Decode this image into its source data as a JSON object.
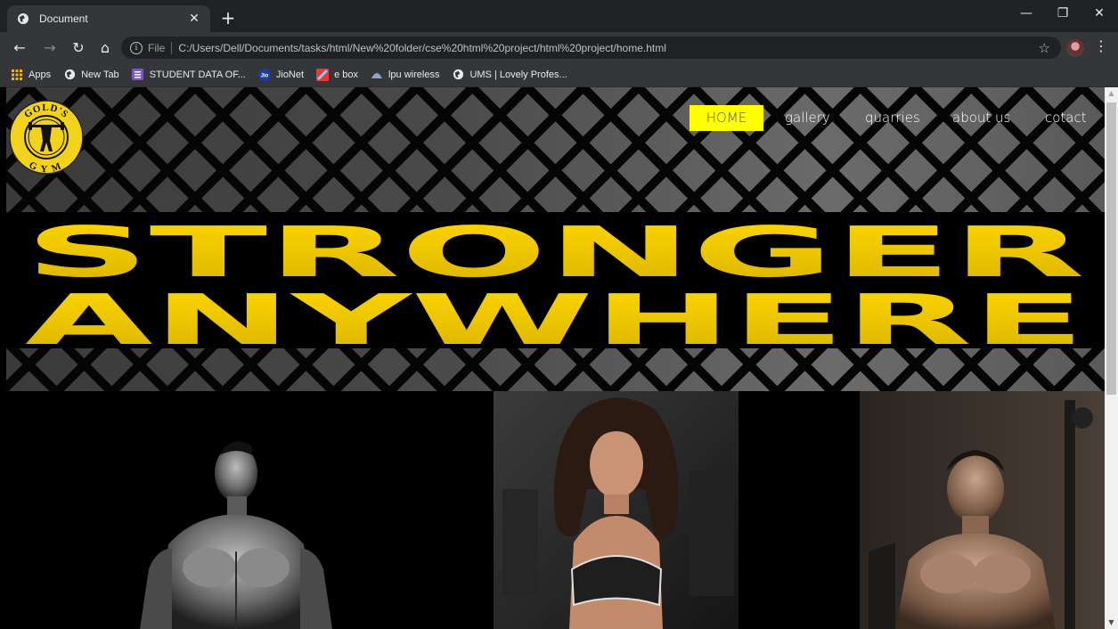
{
  "browser": {
    "tab_title": "Document",
    "url_scheme": "File",
    "url": "C:/Users/Dell/Documents/tasks/html/New%20folder/cse%20html%20project/html%20project/home.html",
    "bookmarks": [
      {
        "label": "Apps",
        "icon": "apps-grid-icon"
      },
      {
        "label": "New Tab",
        "icon": "globe-icon"
      },
      {
        "label": "STUDENT DATA OF...",
        "icon": "list-icon"
      },
      {
        "label": "JioNet",
        "icon": "jio-icon"
      },
      {
        "label": "e box",
        "icon": "ebox-icon"
      },
      {
        "label": "lpu wireless",
        "icon": "cloud-icon"
      },
      {
        "label": "UMS | Lovely Profes...",
        "icon": "globe-icon"
      }
    ]
  },
  "page": {
    "logo_text_top": "GOLD'S",
    "logo_text_bottom": "GYM",
    "nav": [
      {
        "label": "HOME",
        "active": true
      },
      {
        "label": "gallery",
        "active": false
      },
      {
        "label": "quarries",
        "active": false
      },
      {
        "label": "about us",
        "active": false
      },
      {
        "label": "cotact",
        "active": false
      }
    ],
    "banner_line1": "STRONGER",
    "banner_line2": "ANYWHERE",
    "colors": {
      "accent": "#ffff00",
      "banner_text": "#e8c300",
      "background": "#000000"
    }
  }
}
